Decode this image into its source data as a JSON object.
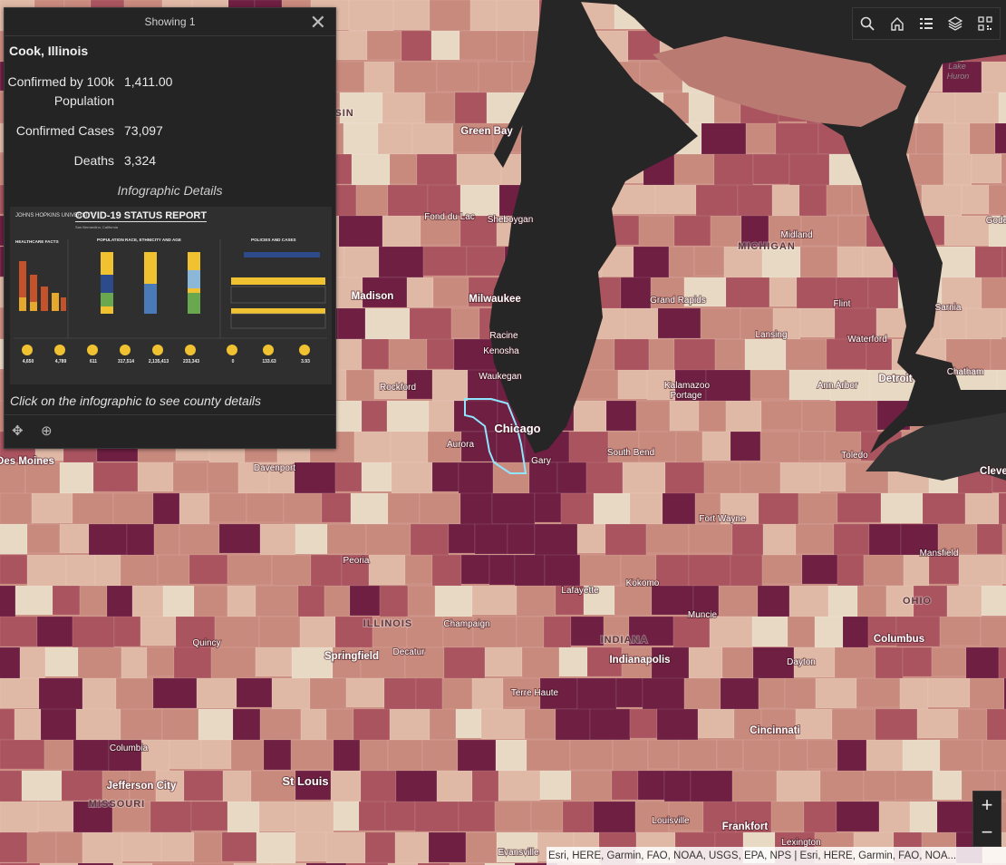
{
  "colors": {
    "water": "#262626",
    "c1": "#e8d9c4",
    "c2": "#e0b8a6",
    "c3": "#c98a7e",
    "c4": "#a9545f",
    "c5": "#6e1f42",
    "highlight": "#8fe6ff"
  },
  "popup": {
    "header": "Showing 1",
    "close_icon": "close-icon",
    "title": "Cook, Illinois",
    "fields": [
      {
        "label": "Confirmed by 100k Population",
        "value": "1,411.00"
      },
      {
        "label": "Confirmed Cases",
        "value": "73,097"
      },
      {
        "label": "Deaths",
        "value": "3,324"
      }
    ],
    "infographic_heading": "Infographic Details",
    "infographic": {
      "logo": "JOHNS HOPKINS UNIVERSITY",
      "title": "COVID-19 STATUS REPORT",
      "subtitle": "San Bernardino, California",
      "sections": [
        "HEALTHCARE FACTS",
        "POPULATION RACE, ETHNICITY AND AGE",
        "POLICIES AND CASES"
      ],
      "stats": [
        "4,650",
        "4,789",
        "611",
        "317,514",
        "2,135,413",
        "233,343",
        "0",
        "133.63",
        "3.93"
      ]
    },
    "hint": "Click on the infographic to see county details",
    "tools": [
      "move-icon",
      "zoom-to-icon"
    ]
  },
  "toolbar": [
    "search-icon",
    "home-icon",
    "list-icon",
    "layers-icon",
    "qr-icon"
  ],
  "zoom": {
    "in": "+",
    "out": "−"
  },
  "attribution": "Esri, HERE, Garmin, FAO, NOAA, USGS, EPA, NPS | Esri, HERE, Garmin, FAO, NOA...",
  "labels": {
    "states": [
      "MICHIGAN",
      "ILLINOIS",
      "INDIANA",
      "OHIO",
      "MISSOURI",
      "ISIN"
    ],
    "water": [
      "Lake",
      "Huron"
    ],
    "cities": [
      "Green Bay",
      "Fond du Lac",
      "Sheboygan",
      "Madison",
      "Milwaukee",
      "Racine",
      "Kenosha",
      "Waukegan",
      "Rockford",
      "Chicago",
      "Aurora",
      "Gary",
      "South Bend",
      "Midland",
      "Flint",
      "Sarnia",
      "Grand Rapids",
      "Lansing",
      "Waterford",
      "Detroit",
      "Chatham",
      "Kalamazoo",
      "Portage",
      "Ann Arbor",
      "Toledo",
      "Des Moines",
      "Davenport",
      "Fort Wayne",
      "Mansfield",
      "Peoria",
      "Kokomo",
      "Lafayette",
      "Muncie",
      "Champaign",
      "Indianapolis",
      "Columbus",
      "Quincy",
      "Springfield",
      "Decatur",
      "Dayton",
      "Terre Haute",
      "Cincinnati",
      "Columbia",
      "Jefferson City",
      "St Louis",
      "Louisville",
      "Frankfort",
      "Lexington",
      "Evansville",
      "Clevel",
      "Gode"
    ]
  }
}
